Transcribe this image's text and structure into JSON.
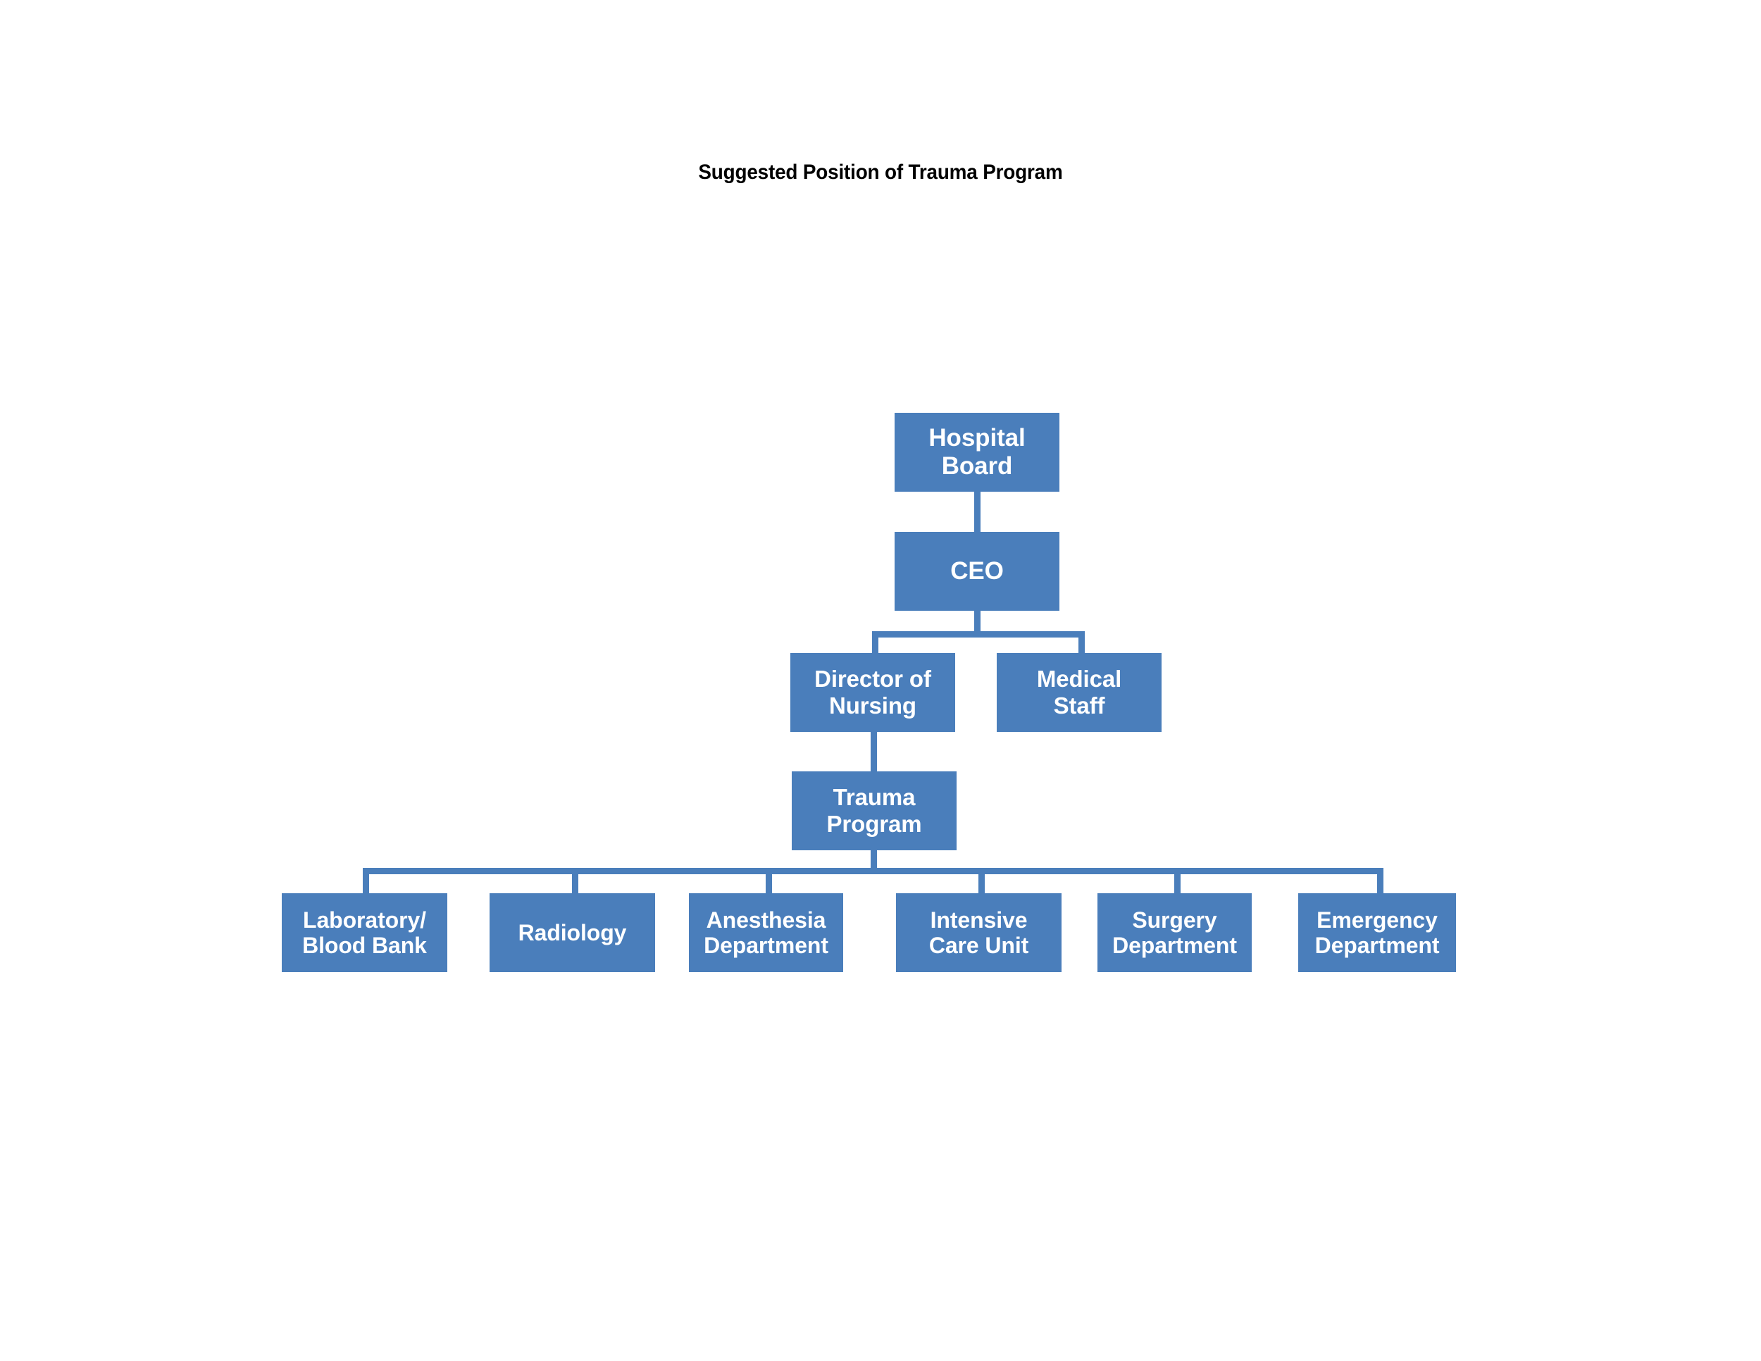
{
  "title": "Suggested Position of Trauma Program",
  "theme": {
    "box_fill": "#4a7ebb",
    "box_text": "#ffffff",
    "connector": "#4a7ebb",
    "background": "#ffffff",
    "title_color": "#000000"
  },
  "chart_data": {
    "type": "diagram",
    "diagram_type": "organizational-chart",
    "title": "Suggested Position of Trauma Program",
    "nodes": [
      {
        "id": "hospital-board",
        "label": "Hospital\nBoard",
        "level": 0
      },
      {
        "id": "ceo",
        "label": "CEO",
        "level": 1
      },
      {
        "id": "director-of-nursing",
        "label": "Director of\nNursing",
        "level": 2
      },
      {
        "id": "medical-staff",
        "label": "Medical\nStaff",
        "level": 2
      },
      {
        "id": "trauma-program",
        "label": "Trauma\nProgram",
        "level": 3
      },
      {
        "id": "laboratory-blood-bank",
        "label": "Laboratory/\nBlood Bank",
        "level": 4
      },
      {
        "id": "radiology",
        "label": "Radiology",
        "level": 4
      },
      {
        "id": "anesthesia-department",
        "label": "Anesthesia\nDepartment",
        "level": 4
      },
      {
        "id": "intensive-care-unit",
        "label": "Intensive\nCare Unit",
        "level": 4
      },
      {
        "id": "surgery-department",
        "label": "Surgery\nDepartment",
        "level": 4
      },
      {
        "id": "emergency-department",
        "label": "Emergency\nDepartment",
        "level": 4
      }
    ],
    "edges": [
      {
        "from": "hospital-board",
        "to": "ceo"
      },
      {
        "from": "ceo",
        "to": "director-of-nursing"
      },
      {
        "from": "ceo",
        "to": "medical-staff"
      },
      {
        "from": "director-of-nursing",
        "to": "trauma-program"
      },
      {
        "from": "trauma-program",
        "to": "laboratory-blood-bank"
      },
      {
        "from": "trauma-program",
        "to": "radiology"
      },
      {
        "from": "trauma-program",
        "to": "anesthesia-department"
      },
      {
        "from": "trauma-program",
        "to": "intensive-care-unit"
      },
      {
        "from": "trauma-program",
        "to": "surgery-department"
      },
      {
        "from": "trauma-program",
        "to": "emergency-department"
      }
    ]
  },
  "nodes": {
    "hospital_board": "Hospital\nBoard",
    "ceo": "CEO",
    "director_of_nursing": "Director of\nNursing",
    "medical_staff": "Medical\nStaff",
    "trauma_program": "Trauma\nProgram",
    "laboratory_blood_bank": "Laboratory/\nBlood Bank",
    "radiology": "Radiology",
    "anesthesia_department": "Anesthesia\nDepartment",
    "intensive_care_unit": "Intensive\nCare Unit",
    "surgery_department": "Surgery\nDepartment",
    "emergency_department": "Emergency\nDepartment"
  }
}
